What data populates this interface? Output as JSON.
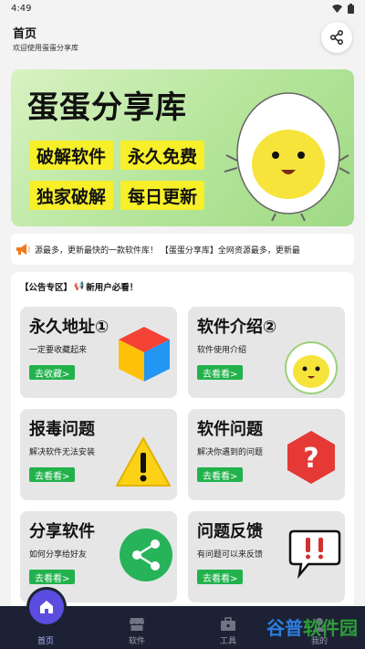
{
  "status_bar": {
    "time": "4:49"
  },
  "header": {
    "title": "首页",
    "subtitle": "欢迎使用蛋蛋分享库"
  },
  "banner": {
    "title": "蛋蛋分享库",
    "tags": [
      "破解软件",
      "永久免费",
      "独家破解",
      "每日更新"
    ]
  },
  "notice": {
    "text": "源最多，更新最快的一款软件库！   【蛋蛋分享库】全网资源最多，更新最"
  },
  "panel": {
    "heading": "【公告专区】",
    "heading_emoji": "📢",
    "heading_suffix": "新用户必看！",
    "cards": [
      {
        "title": "永久地址①",
        "desc": "一定要收藏起来",
        "button": "去收藏>"
      },
      {
        "title": "软件介绍②",
        "desc": "软件使用介绍",
        "button": "去看看>"
      },
      {
        "title": "报毒问题",
        "desc": "解决软件无法安装",
        "button": "去看看>"
      },
      {
        "title": "软件问题",
        "desc": "解决你遇到的问题",
        "button": "去看看>"
      },
      {
        "title": "分享软件",
        "desc": "如何分享给好友",
        "button": "去看看>"
      },
      {
        "title": "问题反馈",
        "desc": "有问题可以来反馈",
        "button": "去看看>"
      }
    ]
  },
  "tabbar": {
    "tabs": [
      {
        "label": "首页",
        "icon": "home-icon",
        "active": true
      },
      {
        "label": "软件",
        "icon": "store-icon",
        "active": false
      },
      {
        "label": "工具",
        "icon": "toolbox-icon",
        "active": false
      },
      {
        "label": "我的",
        "icon": "user-icon",
        "active": false
      }
    ]
  },
  "watermark": {
    "part1": "谷普",
    "part2": "软件园"
  },
  "colors": {
    "accent": "#5a4de0",
    "tag_yellow": "#f7ef2a",
    "button_green": "#22b24c",
    "tabbar_bg": "#1c2233"
  }
}
